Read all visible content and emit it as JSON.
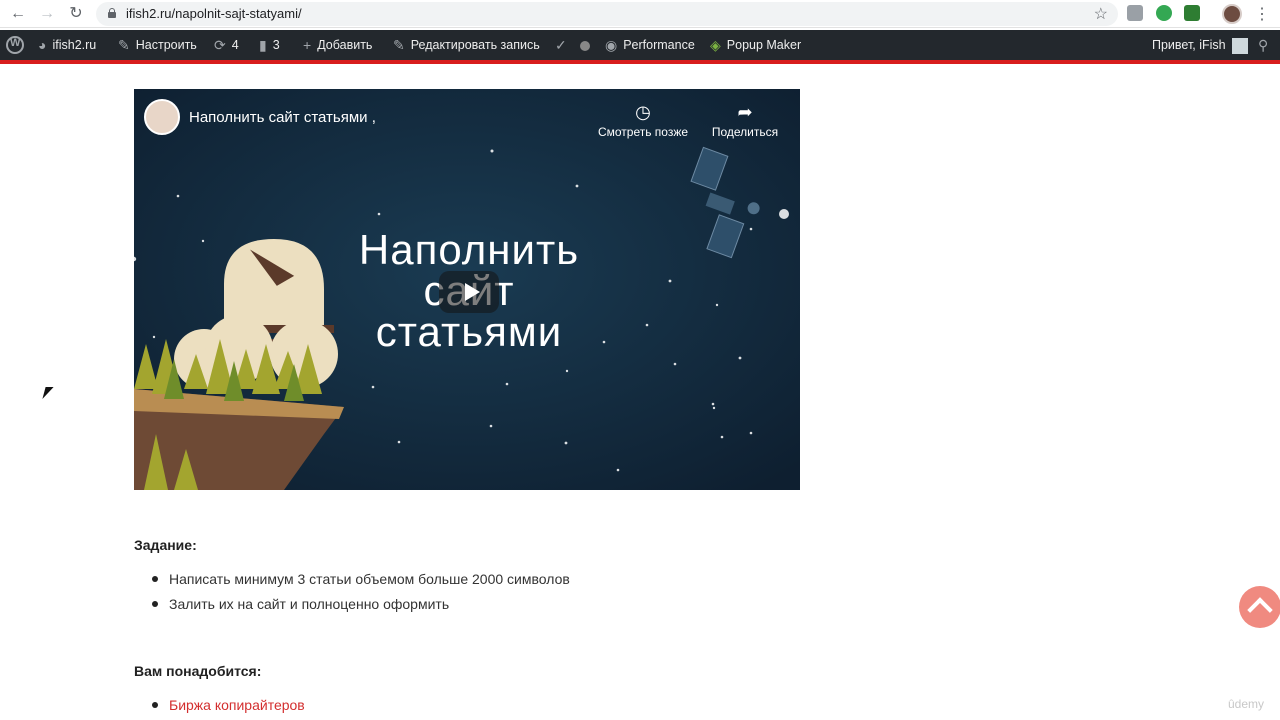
{
  "browser": {
    "back_icon": "arrow-left-icon",
    "forward_icon": "arrow-right-icon",
    "reload_icon": "reload-icon",
    "url": "ifish2.ru/napolnit-sajt-statyami/",
    "bookmark_icon": "star-icon",
    "menu_icon": "more-vert-icon"
  },
  "adminbar": {
    "site": "ifish2.ru",
    "customize": "Настроить",
    "updates_count": "4",
    "comments_count": "3",
    "add_new": "Добавить",
    "edit_post": "Редактировать запись",
    "performance": "Performance",
    "popup_maker": "Popup Maker",
    "howdy": "Привет, iFish",
    "accent_color": "#d81d1d"
  },
  "video": {
    "title": "Наполнить сайт статьями ,",
    "watch_later": "Смотреть позже",
    "share": "Поделиться",
    "headline_line1": "Наполнить",
    "headline_line2": "сайт",
    "headline_line3": "статьями",
    "background_color": "#12263a"
  },
  "task": {
    "heading": "Задание:",
    "items": [
      "Написать минимум 3 статьи объемом больше 2000 символов",
      "Залить их на сайт и полноценно оформить"
    ]
  },
  "needs": {
    "heading": "Вам понадобится:",
    "link": "Биржа копирайтеров",
    "link_color": "#d32f2f"
  },
  "watermark": "ûdemy"
}
